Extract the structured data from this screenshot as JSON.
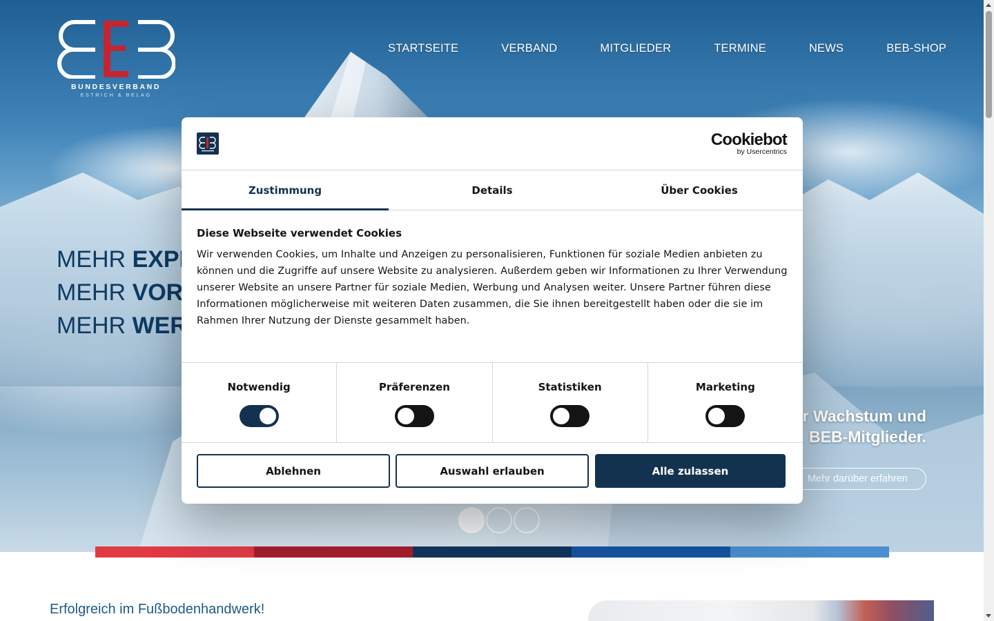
{
  "header": {
    "logo_text": "BUNDESVERBAND",
    "logo_subtext": "ESTRICH & BELAG",
    "nav": [
      {
        "label": "STARTSEITE"
      },
      {
        "label": "VERBAND"
      },
      {
        "label": "MITGLIEDER"
      },
      {
        "label": "TERMINE"
      },
      {
        "label": "NEWS"
      },
      {
        "label": "BEB-SHOP"
      }
    ]
  },
  "hero": {
    "lines": [
      {
        "prefix": "MEHR ",
        "bold": "EXPE"
      },
      {
        "prefix": "MEHR ",
        "bold": "VORS"
      },
      {
        "prefix": "MEHR ",
        "bold": "WERT"
      }
    ],
    "right_text_line1": "r Wachstum und",
    "right_text_line2": "BEB-Mitglieder.",
    "cta_label": "Mehr darüber erfahren",
    "slider_dots": 3,
    "active_dot": 1
  },
  "band_colors": [
    "#e23a45",
    "#a51e2d",
    "#12355c",
    "#1553a0",
    "#4a8ed0"
  ],
  "section": {
    "heading": "Erfolgreich im Fußbodenhandwerk!"
  },
  "cookie_dialog": {
    "brand_name": "Cookiebot",
    "brand_sub": "by Usercentrics",
    "tabs": [
      {
        "label": "Zustimmung",
        "active": true
      },
      {
        "label": "Details",
        "active": false
      },
      {
        "label": "Über Cookies",
        "active": false
      }
    ],
    "title": "Diese Webseite verwendet Cookies",
    "text": "Wir verwenden Cookies, um Inhalte und Anzeigen zu personalisieren, Funktionen für soziale Medien anbieten zu können und die Zugriffe auf unsere Website zu analysieren. Außerdem geben wir Informationen zu Ihrer Verwendung unserer Website an unsere Partner für soziale Medien, Werbung und Analysen weiter. Unsere Partner führen diese Informationen möglicherweise mit weiteren Daten zusammen, die Sie ihnen bereitgestellt haben oder die sie im Rahmen Ihrer Nutzung der Dienste gesammelt haben.",
    "toggles": [
      {
        "label": "Notwendig",
        "on": true
      },
      {
        "label": "Präferenzen",
        "on": false
      },
      {
        "label": "Statistiken",
        "on": false
      },
      {
        "label": "Marketing",
        "on": false
      }
    ],
    "buttons": {
      "decline": "Ablehnen",
      "allow_selection": "Auswahl erlauben",
      "allow_all": "Alle zulassen"
    }
  },
  "colors": {
    "primary": "#13324f",
    "slogan": "#0e3a63",
    "heading": "#1c5a8a"
  }
}
